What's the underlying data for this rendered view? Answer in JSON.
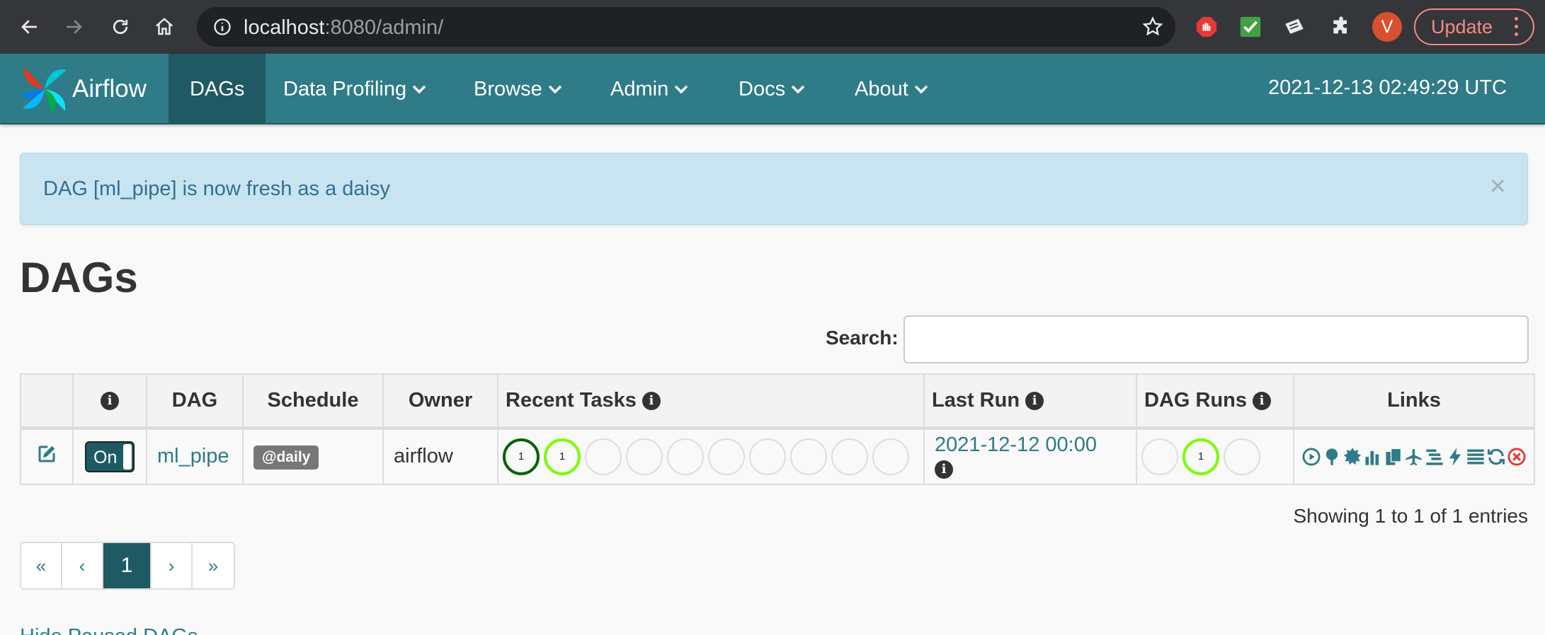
{
  "browser": {
    "url_host": "localhost",
    "url_rest": ":8080/admin/",
    "profile_initial": "V",
    "update_label": "Update"
  },
  "navbar": {
    "brand": "Airflow",
    "items": [
      {
        "label": "DAGs"
      },
      {
        "label": "Data Profiling"
      },
      {
        "label": "Browse"
      },
      {
        "label": "Admin"
      },
      {
        "label": "Docs"
      },
      {
        "label": "About"
      }
    ],
    "clock": "2021-12-13 02:49:29 UTC"
  },
  "alert": {
    "message": "DAG [ml_pipe] is now fresh as a daisy",
    "close": "×"
  },
  "page": {
    "title": "DAGs",
    "search_label": "Search:",
    "search_value": "",
    "entries_info": "Showing 1 to 1 of 1 entries",
    "hide_paused": "Hide Paused DAGs"
  },
  "table": {
    "headers": [
      "",
      "",
      "DAG",
      "Schedule",
      "Owner",
      "Recent Tasks",
      "Last Run",
      "DAG Runs",
      "Links"
    ],
    "rows": [
      {
        "toggle": "On",
        "dag": "ml_pipe",
        "schedule": "@daily",
        "owner": "airflow",
        "recent_tasks": [
          "1",
          "1",
          "",
          "",
          "",
          "",
          "",
          "",
          "",
          ""
        ],
        "last_run": "2021-12-12 00:00",
        "dag_runs": [
          "",
          "1",
          ""
        ]
      }
    ]
  },
  "pagination": {
    "first": "«",
    "prev": "‹",
    "current": "1",
    "next": "›",
    "last": "»"
  },
  "colors": {
    "navbar": "#2f7b87",
    "navbar_active": "#1f5963",
    "success": "#006400",
    "running": "#7cfc00",
    "link": "#2f7b87"
  }
}
